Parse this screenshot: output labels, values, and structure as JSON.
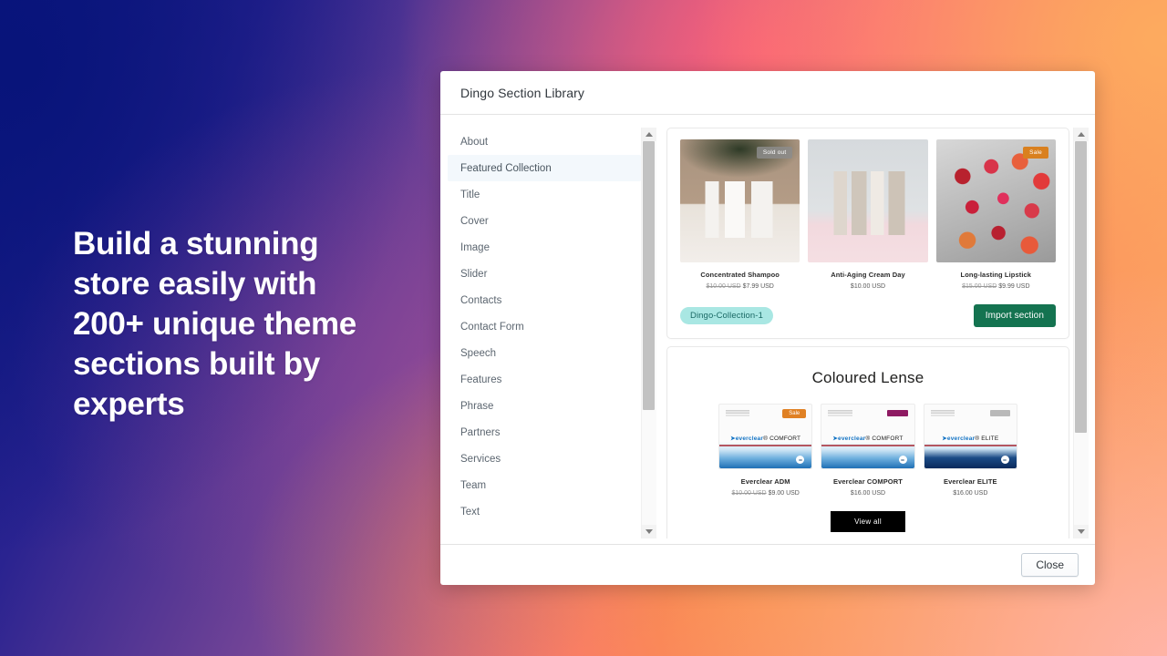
{
  "promo": {
    "headline": "Build a stunning store easily with 200+ unique theme sections built by experts"
  },
  "modal": {
    "title": "Dingo Section Library",
    "close_label": "Close"
  },
  "sidebar": {
    "items": [
      {
        "label": "About",
        "active": false
      },
      {
        "label": "Featured Collection",
        "active": true
      },
      {
        "label": "Title",
        "active": false
      },
      {
        "label": "Cover",
        "active": false
      },
      {
        "label": "Image",
        "active": false
      },
      {
        "label": "Slider",
        "active": false
      },
      {
        "label": "Contacts",
        "active": false
      },
      {
        "label": "Contact Form",
        "active": false
      },
      {
        "label": "Speech",
        "active": false
      },
      {
        "label": "Features",
        "active": false
      },
      {
        "label": "Phrase",
        "active": false
      },
      {
        "label": "Partners",
        "active": false
      },
      {
        "label": "Services",
        "active": false
      },
      {
        "label": "Team",
        "active": false
      },
      {
        "label": "Text",
        "active": false
      }
    ]
  },
  "sections": [
    {
      "heading": "",
      "products": [
        {
          "name": "Concentrated Shampoo",
          "price_old": "$10.00 USD",
          "price": "$7.99 USD",
          "badge": "Sold out",
          "badge_kind": "soldout",
          "photo": "ph-shampoo"
        },
        {
          "name": "Anti-Aging Cream Day",
          "price_old": "",
          "price": "$10.00 USD",
          "badge": "",
          "badge_kind": "",
          "photo": "ph-cream"
        },
        {
          "name": "Long-lasting Lipstick",
          "price_old": "$15.00 USD",
          "price": "$9.99 USD",
          "badge": "Sale",
          "badge_kind": "sale",
          "photo": "ph-lipstick"
        }
      ],
      "tag": "Dingo-Collection-1",
      "import_label": "Import section"
    },
    {
      "heading": "Coloured Lense",
      "products": [
        {
          "name": "Everclear ADM",
          "price_old": "$10.00 USD",
          "price": "$9.00 USD",
          "badge": "Sale",
          "badge_kind": "sale",
          "brand": "everclear",
          "variant": "COMFORT",
          "wave": "light",
          "chip": "#e08124"
        },
        {
          "name": "Everclear COMPORT",
          "price_old": "",
          "price": "$16.00 USD",
          "badge": "",
          "badge_kind": "",
          "brand": "everclear",
          "variant": "COMFORT",
          "wave": "light",
          "chip": "#8e1a62"
        },
        {
          "name": "Everclear ELITE",
          "price_old": "",
          "price": "$16.00 USD",
          "badge": "",
          "badge_kind": "",
          "brand": "everclear",
          "variant": "ELITE",
          "wave": "dark",
          "chip": "#b9b9b9"
        }
      ],
      "view_all_label": "View all"
    }
  ],
  "colors": {
    "accent_green": "#147350",
    "tag_bg": "#a9e7e3",
    "sale_orange": "#d9801f",
    "active_item_bg": "#f3f8fc"
  },
  "scrollbars": {
    "sidebar": {
      "thumb_top_pct": 0,
      "thumb_height_pct": 70
    },
    "content": {
      "thumb_top_pct": 0,
      "thumb_height_pct": 76
    }
  }
}
